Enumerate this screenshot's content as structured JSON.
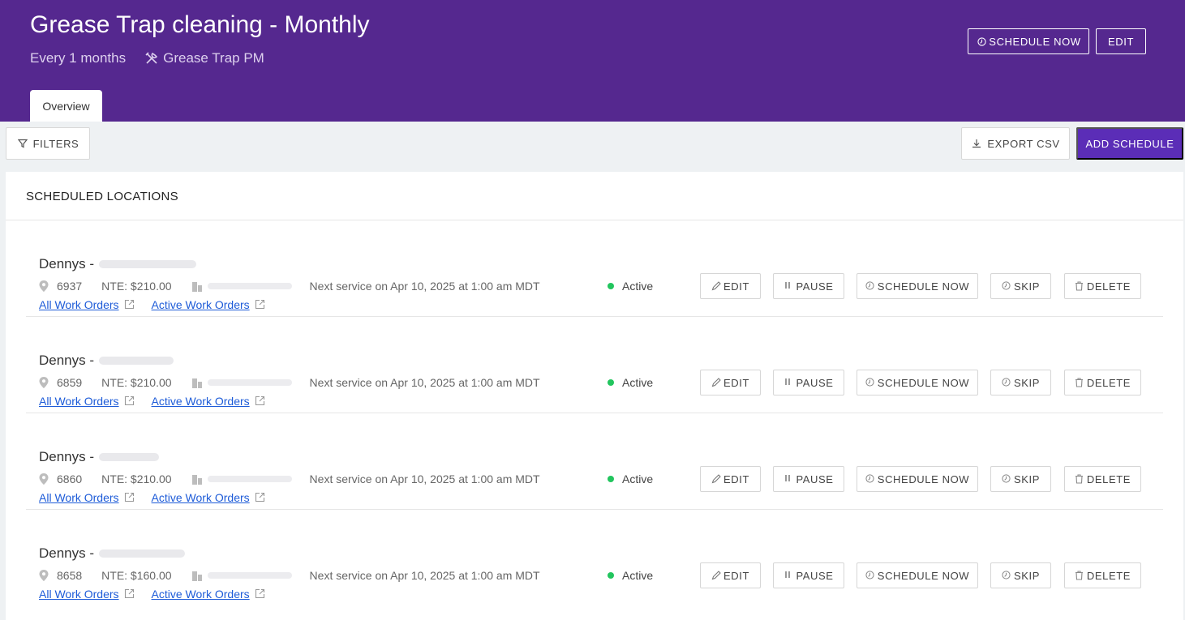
{
  "header": {
    "title": "Grease Trap cleaning - Monthly",
    "frequency": "Every 1 months",
    "trade": "Grease Trap PM",
    "schedule_now_label": "SCHEDULE NOW",
    "edit_label": "EDIT"
  },
  "tabs": [
    {
      "label": "Overview",
      "active": true
    }
  ],
  "toolbar": {
    "filters_label": "FILTERS",
    "export_label": "EXPORT CSV",
    "add_label": "ADD SCHEDULE"
  },
  "section": {
    "title": "SCHEDULED LOCATIONS"
  },
  "row_actions": {
    "edit": "EDIT",
    "pause": "PAUSE",
    "schedule_now": "SCHEDULE NOW",
    "skip": "SKIP",
    "delete": "DELETE"
  },
  "links": {
    "all": "All Work Orders",
    "active": "Active Work Orders"
  },
  "locations": [
    {
      "name": "Dennys -",
      "store": "6937",
      "nte": "NTE: $210.00",
      "next": "Next service on Apr 10, 2025 at 1:00 am MDT",
      "status": "Active"
    },
    {
      "name": "Dennys -",
      "store": "6859",
      "nte": "NTE: $210.00",
      "next": "Next service on Apr 10, 2025 at 1:00 am MDT",
      "status": "Active"
    },
    {
      "name": "Dennys -",
      "store": "6860",
      "nte": "NTE: $210.00",
      "next": "Next service on Apr 10, 2025 at 1:00 am MDT",
      "status": "Active"
    },
    {
      "name": "Dennys -",
      "store": "8658",
      "nte": "NTE: $160.00",
      "next": "Next service on Apr 10, 2025 at 1:00 am MDT",
      "status": "Active"
    }
  ],
  "colors": {
    "header_bg": "#55288f",
    "primary": "#5b2db7",
    "active": "#22c55e",
    "link": "#1d5bd8"
  }
}
